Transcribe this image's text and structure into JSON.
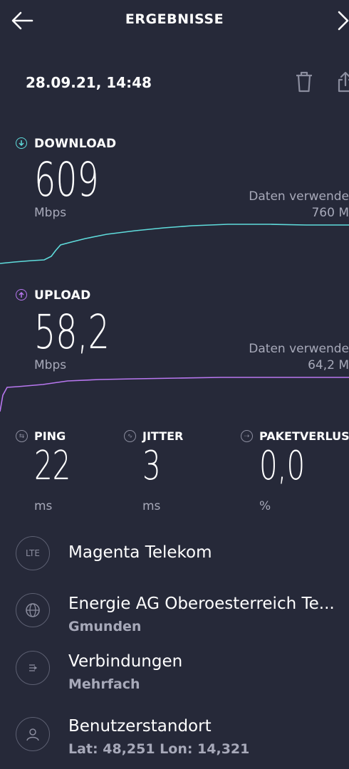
{
  "header": {
    "title": "ERGEBNISSE"
  },
  "result": {
    "timestamp": "28.09.21, 14:48"
  },
  "download": {
    "label": "DOWNLOAD",
    "value": "609",
    "unit": "Mbps",
    "data_used_label": "Daten verwende",
    "data_used_value": "760 M",
    "accent": "#5fdcdc"
  },
  "upload": {
    "label": "UPLOAD",
    "value": "58,2",
    "unit": "Mbps",
    "data_used_label": "Daten verwende",
    "data_used_value": "64,2 M",
    "accent": "#b877f0"
  },
  "ping": {
    "label": "PING",
    "value": "22",
    "unit": "ms"
  },
  "jitter": {
    "label": "JITTER",
    "value": "3",
    "unit": "ms"
  },
  "packet_loss": {
    "label": "PAKETVERLUS",
    "value": "0,0",
    "unit": "%"
  },
  "info": {
    "carrier": {
      "icon_text": "LTE",
      "title": "Magenta Telekom"
    },
    "server": {
      "title": "Energie AG Oberoesterreich Te...",
      "subtitle": "Gmunden"
    },
    "connections": {
      "title": "Verbindungen",
      "subtitle": "Mehrfach"
    },
    "location": {
      "title": "Benutzerstandort",
      "subtitle": "Lat: 48,251 Lon: 14,321"
    }
  },
  "icons": {
    "back": "arrow-left-icon",
    "close": "chevron-right-icon",
    "delete": "trash-icon",
    "share": "share-icon"
  }
}
